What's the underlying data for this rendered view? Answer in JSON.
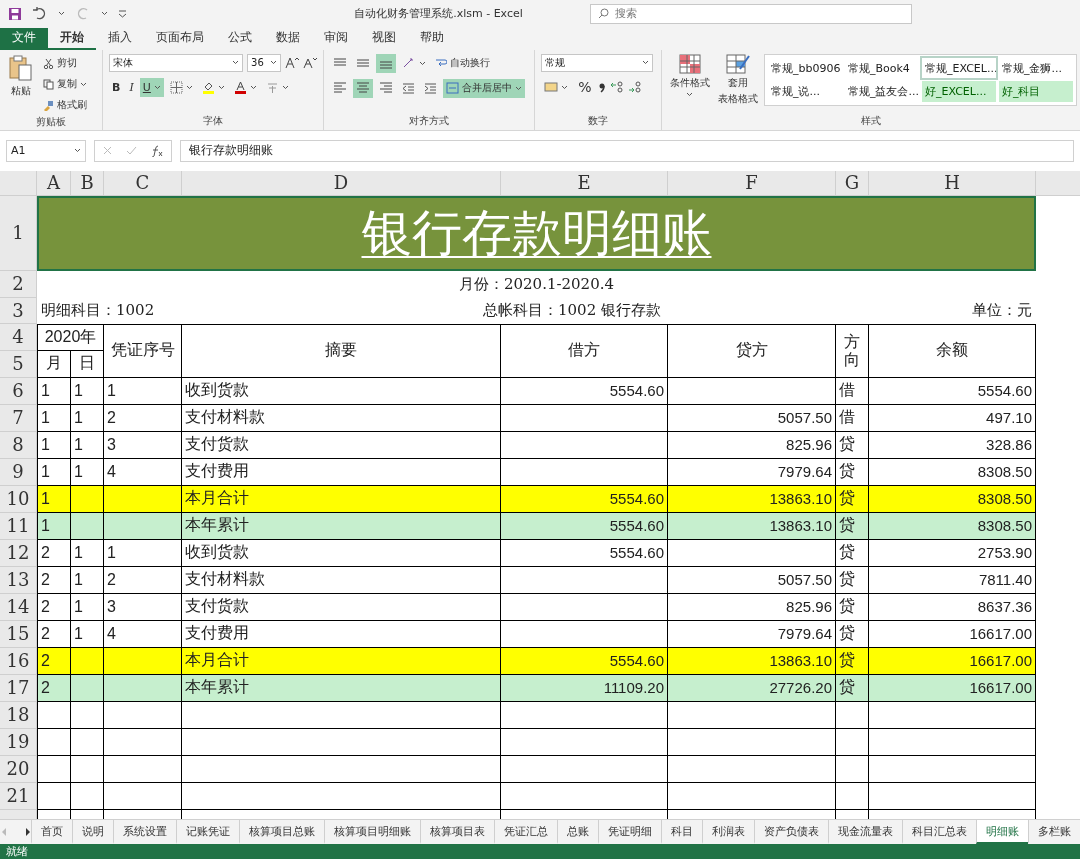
{
  "title_bar": {
    "title": "自动化财务管理系统.xlsm  -  Excel",
    "search_placeholder": "搜索"
  },
  "ribbon_tabs": [
    {
      "label": "文件",
      "kind": "file",
      "selected": false
    },
    {
      "label": "开始",
      "kind": "tab",
      "selected": true
    },
    {
      "label": "插入",
      "kind": "tab",
      "selected": false
    },
    {
      "label": "页面布局",
      "kind": "tab",
      "selected": false
    },
    {
      "label": "公式",
      "kind": "tab",
      "selected": false
    },
    {
      "label": "数据",
      "kind": "tab",
      "selected": false
    },
    {
      "label": "审阅",
      "kind": "tab",
      "selected": false
    },
    {
      "label": "视图",
      "kind": "tab",
      "selected": false
    },
    {
      "label": "帮助",
      "kind": "tab",
      "selected": false
    }
  ],
  "clipboard": {
    "paste": "粘贴",
    "cut": "剪切",
    "copy": "复制",
    "painter": "格式刷",
    "label": "剪贴板"
  },
  "font": {
    "name": "宋体",
    "size": "36",
    "bold": "B",
    "italic": "I",
    "underline": {
      "label": "U",
      "on": true
    },
    "label": "字体"
  },
  "alignment": {
    "vertical": [
      {
        "kind": "top",
        "on": false
      },
      {
        "kind": "middle",
        "on": false
      },
      {
        "kind": "bottom",
        "on": true
      }
    ],
    "horizontal": [
      {
        "kind": "left",
        "on": false
      },
      {
        "kind": "center",
        "on": true
      },
      {
        "kind": "right",
        "on": false
      }
    ],
    "wrap": "自动换行",
    "merge": {
      "label": "合并后居中",
      "on": true
    },
    "label": "对齐方式"
  },
  "number": {
    "format": "常规",
    "percent": "%",
    "label": "数字"
  },
  "styles": {
    "conditional": "条件格式",
    "table_top": "套用",
    "table_bottom": "表格格式",
    "label": "样式",
    "gallery": [
      {
        "label": "常规_bb0906",
        "kind": "normal",
        "selected": false
      },
      {
        "label": "常规_Book4",
        "kind": "normal",
        "selected": false
      },
      {
        "label": "常规_EXCEL...",
        "kind": "normal",
        "selected": true
      },
      {
        "label": "常规_金狮...",
        "kind": "normal",
        "selected": false
      },
      {
        "label": "常规_说...",
        "kind": "normal",
        "selected": false
      },
      {
        "label": "常规_益友会...",
        "kind": "normal",
        "selected": false
      },
      {
        "label": "好_EXCEL...",
        "kind": "good",
        "selected": false
      },
      {
        "label": "好_科目",
        "kind": "good",
        "selected": false
      }
    ]
  },
  "formula_bar": {
    "name_box": "A1",
    "value": "银行存款明细账"
  },
  "columns": [
    "A",
    "B",
    "C",
    "D",
    "E",
    "F",
    "G",
    "H"
  ],
  "top_row_numbers": [
    "1",
    "2",
    "3",
    "4",
    "5"
  ],
  "sheet": {
    "title": "银行存款明细账",
    "period": "月份：2020.1-2020.4",
    "detail_account": "明细科目：1002",
    "general_account": "总帐科目：1002  银行存款",
    "unit": "单位：元",
    "header": {
      "year": "2020年",
      "month": "月",
      "day": "日",
      "voucher": "凭证序号",
      "summary": "摘要",
      "debit": "借方",
      "credit": "贷方",
      "direction": "方向",
      "balance": "余额"
    },
    "rows": [
      {
        "row": "6",
        "kind": "entry",
        "month": "1",
        "day": "1",
        "voucher": "1",
        "summary": "收到货款",
        "debit": "5554.60",
        "credit": "",
        "direction": "借",
        "balance": "5554.60"
      },
      {
        "row": "7",
        "kind": "entry",
        "month": "1",
        "day": "1",
        "voucher": "2",
        "summary": "支付材料款",
        "debit": "",
        "credit": "5057.50",
        "direction": "借",
        "balance": "497.10"
      },
      {
        "row": "8",
        "kind": "entry",
        "month": "1",
        "day": "1",
        "voucher": "3",
        "summary": "支付货款",
        "debit": "",
        "credit": "825.96",
        "direction": "贷",
        "balance": "328.86"
      },
      {
        "row": "9",
        "kind": "entry",
        "month": "1",
        "day": "1",
        "voucher": "4",
        "summary": "支付费用",
        "debit": "",
        "credit": "7979.64",
        "direction": "贷",
        "balance": "8308.50"
      },
      {
        "row": "10",
        "kind": "month_total",
        "month": "1",
        "day": "",
        "voucher": "",
        "summary": "本月合计",
        "debit": "5554.60",
        "credit": "13863.10",
        "direction": "贷",
        "balance": "8308.50"
      },
      {
        "row": "11",
        "kind": "year_total",
        "month": "1",
        "day": "",
        "voucher": "",
        "summary": "本年累计",
        "debit": "5554.60",
        "credit": "13863.10",
        "direction": "贷",
        "balance": "8308.50"
      },
      {
        "row": "12",
        "kind": "entry",
        "month": "2",
        "day": "1",
        "voucher": "1",
        "summary": "收到货款",
        "debit": "5554.60",
        "credit": "",
        "direction": "贷",
        "balance": "2753.90"
      },
      {
        "row": "13",
        "kind": "entry",
        "month": "2",
        "day": "1",
        "voucher": "2",
        "summary": "支付材料款",
        "debit": "",
        "credit": "5057.50",
        "direction": "贷",
        "balance": "7811.40"
      },
      {
        "row": "14",
        "kind": "entry",
        "month": "2",
        "day": "1",
        "voucher": "3",
        "summary": "支付货款",
        "debit": "",
        "credit": "825.96",
        "direction": "贷",
        "balance": "8637.36"
      },
      {
        "row": "15",
        "kind": "entry",
        "month": "2",
        "day": "1",
        "voucher": "4",
        "summary": "支付费用",
        "debit": "",
        "credit": "7979.64",
        "direction": "贷",
        "balance": "16617.00"
      },
      {
        "row": "16",
        "kind": "month_total",
        "month": "2",
        "day": "",
        "voucher": "",
        "summary": "本月合计",
        "debit": "5554.60",
        "credit": "13863.10",
        "direction": "贷",
        "balance": "16617.00"
      },
      {
        "row": "17",
        "kind": "year_total",
        "month": "2",
        "day": "",
        "voucher": "",
        "summary": "本年累计",
        "debit": "11109.20",
        "credit": "27726.20",
        "direction": "贷",
        "balance": "16617.00"
      },
      {
        "row": "18",
        "kind": "empty"
      },
      {
        "row": "19",
        "kind": "empty"
      },
      {
        "row": "20",
        "kind": "empty"
      },
      {
        "row": "21",
        "kind": "empty"
      }
    ]
  },
  "sheet_tabs": [
    {
      "label": "首页",
      "selected": false
    },
    {
      "label": "说明",
      "selected": false
    },
    {
      "label": "系统设置",
      "selected": false
    },
    {
      "label": "记账凭证",
      "selected": false
    },
    {
      "label": "核算项目总账",
      "selected": false
    },
    {
      "label": "核算项目明细账",
      "selected": false
    },
    {
      "label": "核算项目表",
      "selected": false
    },
    {
      "label": "凭证汇总",
      "selected": false
    },
    {
      "label": "总账",
      "selected": false
    },
    {
      "label": "凭证明细",
      "selected": false
    },
    {
      "label": "科目",
      "selected": false
    },
    {
      "label": "利润表",
      "selected": false
    },
    {
      "label": "资产负债表",
      "selected": false
    },
    {
      "label": "现金流量表",
      "selected": false
    },
    {
      "label": "科目汇总表",
      "selected": false
    },
    {
      "label": "明细账",
      "selected": true
    },
    {
      "label": "多栏账",
      "selected": false
    }
  ],
  "status": "就绪"
}
